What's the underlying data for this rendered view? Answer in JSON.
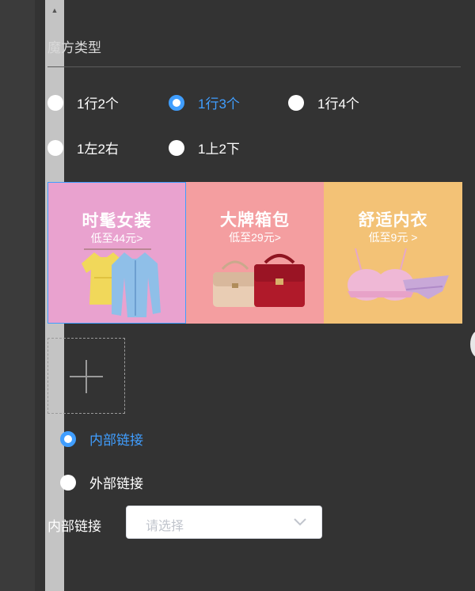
{
  "panel": {
    "section_title": "魔方类型"
  },
  "layout_options": [
    {
      "label": "1行2个",
      "checked": false
    },
    {
      "label": "1行3个",
      "checked": true
    },
    {
      "label": "1行4个",
      "checked": false
    },
    {
      "label": "1左2右",
      "checked": false
    },
    {
      "label": "1上2下",
      "checked": false
    }
  ],
  "cube_items": [
    {
      "title": "时髦女装",
      "subtitle": "低至44元>",
      "color": "#e9a2cf"
    },
    {
      "title": "大牌箱包",
      "subtitle": "低至29元>",
      "color": "#f49ea0"
    },
    {
      "title": "舒适内衣",
      "subtitle": "低至9元 >",
      "color": "#f3c276"
    }
  ],
  "link_type_options": [
    {
      "label": "内部链接",
      "checked": true
    },
    {
      "label": "外部链接",
      "checked": false
    }
  ],
  "link_field": {
    "label": "内部链接",
    "placeholder": "请选择"
  },
  "colors": {
    "accent": "#409eff",
    "background": "#333333"
  }
}
